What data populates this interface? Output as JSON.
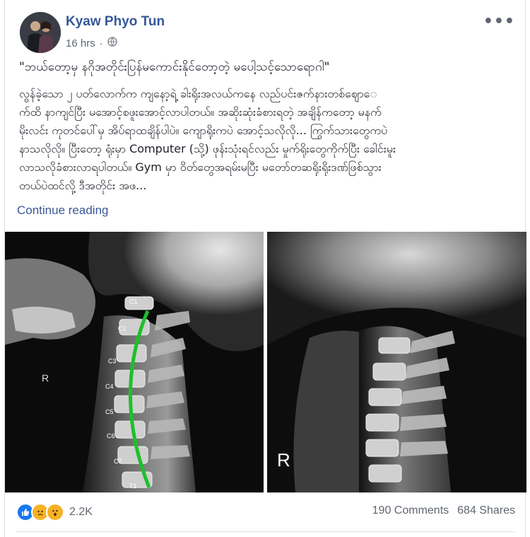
{
  "post": {
    "author": "Kyaw Phyo Tun",
    "time": "16 hrs",
    "separator": "·",
    "privacy_icon": "globe-icon",
    "options_icon": "more-dots-icon",
    "title": "\"ဘယ်တော့မှ နဂိုအတိုင်းပြန်မကောင်းနိုင်တော့တဲ့ မပေါ့သင့်သောရောဂါ\"",
    "body_lines": [
      "လွန်ခဲ့သော ၂ ပတ်လောက်က ကျနော့ရဲ့ ခါးရိုးအလယ်ကနေ လည်ပင်းဇက်နားတစ်ဈောေ",
      "က်ထိ နာကျင်ပြီး မအောင့်စဖူးအောင့်လာပါတယ်။ အဆိုးဆုံးခံစားရတဲ့ အချိန်ကတော့ မနက်",
      "မိုးလင်း ကုတင်ပေါ်မှ အိပ်ရာထချိန်ပါပဲ။ ကျောရိုးကပဲ အောင့်သလိုလို... ကြွက်သားတွေကပဲ",
      "နာသလိုလို။ ပြီးတော့ ရုံးမှာ Computer (သို့) ဖုန်းသုံးရင်လည်း မှုက်ရိုးတွေကိုက်ပြီး ခေါင်းမူး",
      "လာသလိုခံစားလာရပါတယ်။ Gym မှာ ဝိတ်တွေအရမ်းမပြီး မတော်တဆရိုးရိုးဒဏ်ဖြစ်သွား",
      "တယ်ပဲထင်လို့ ဒီအတိုင်း အဖ..."
    ],
    "continue_label": "Continue reading",
    "xray_left": {
      "vertebra_labels": [
        "C1",
        "C2",
        "C3",
        "C4",
        "C5",
        "C6",
        "C7",
        "T1"
      ],
      "side_marker": "R"
    },
    "xray_right": {
      "side_marker": "R"
    },
    "reactions": {
      "icons": [
        "like-icon",
        "sad-icon",
        "wow-icon"
      ],
      "count": "2.2K"
    },
    "comments": "190 Comments",
    "shares": "684 Shares"
  }
}
